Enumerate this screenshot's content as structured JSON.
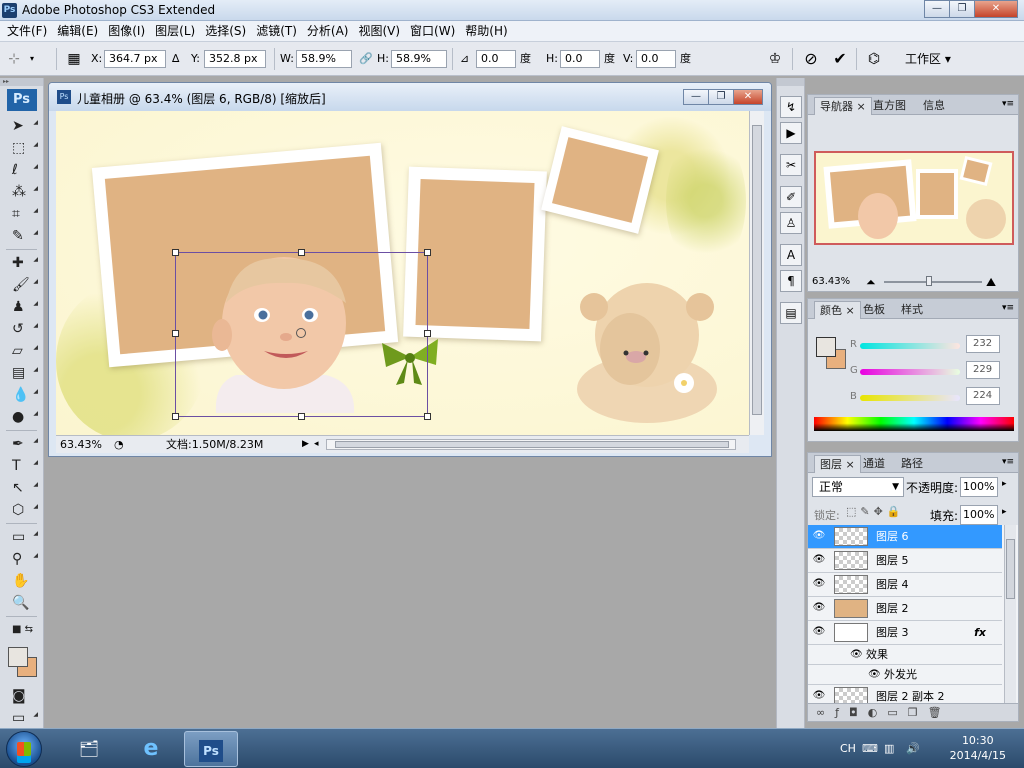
{
  "window": {
    "title": "Adobe Photoshop CS3 Extended",
    "app_icon": "Ps",
    "minimize": "—",
    "maximize": "❐",
    "close": "✕"
  },
  "menu": [
    "文件(F)",
    "编辑(E)",
    "图像(I)",
    "图层(L)",
    "选择(S)",
    "滤镜(T)",
    "分析(A)",
    "视图(V)",
    "窗口(W)",
    "帮助(H)"
  ],
  "options": {
    "x_label": "X:",
    "x_value": "364.7 px",
    "y_label": "Y:",
    "y_value": "352.8 px",
    "w_label": "W:",
    "w_value": "58.9%",
    "h_label": "H:",
    "h_value": "58.9%",
    "angle_value": "0.0",
    "deg1": "度",
    "hskew_label": "H:",
    "hskew_value": "0.0",
    "deg2": "度",
    "vskew_label": "V:",
    "vskew_value": "0.0",
    "deg3": "度",
    "workspace": "工作区 ▾"
  },
  "toolbox": {
    "logo": "Ps"
  },
  "document": {
    "title": "儿童相册 @ 63.4% (图层 6, RGB/8) [缩放后]",
    "zoom": "63.43%",
    "info": "文档:1.50M/8.23M"
  },
  "navigator": {
    "tabs": [
      "导航器",
      "直方图",
      "信息"
    ],
    "zoom": "63.43%"
  },
  "color": {
    "tabs": [
      "颜色",
      "色板",
      "样式"
    ],
    "r_label": "R",
    "r": "232",
    "g_label": "G",
    "g": "229",
    "b_label": "B",
    "b": "224",
    "fg": "#e8e5e0",
    "bg": "#e8b07e"
  },
  "layers": {
    "tabs": [
      "图层",
      "通道",
      "路径"
    ],
    "blend_mode": "正常",
    "opacity_label": "不透明度:",
    "opacity": "100%",
    "lock_label": "锁定:",
    "fill_label": "填充:",
    "fill": "100%",
    "items": [
      {
        "name": "图层 6",
        "selected": true
      },
      {
        "name": "图层 5"
      },
      {
        "name": "图层 4"
      },
      {
        "name": "图层 2"
      },
      {
        "name": "图层 3",
        "fx": "fx"
      },
      {
        "name": "效果"
      },
      {
        "name": "外发光"
      },
      {
        "name": "图层 2 副本 2"
      }
    ]
  },
  "taskbar": {
    "lang": "CH",
    "time": "10:30",
    "date": "2014/4/15",
    "ps_label": "Ps"
  }
}
